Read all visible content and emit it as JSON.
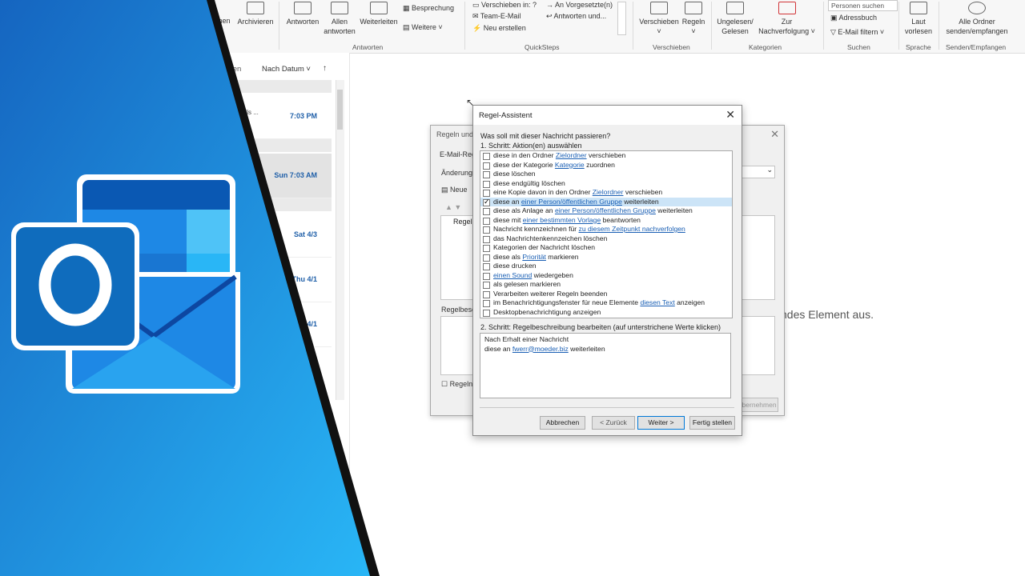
{
  "ribbon": {
    "buttons": {
      "loeschen_partial": "chen",
      "archivieren": "Archivieren",
      "antworten": "Antworten",
      "allen_antworten_1": "Allen",
      "allen_antworten_2": "antworten",
      "weiterleiten": "Weiterleiten",
      "besprechung": "Besprechung",
      "weitere": "Weitere ˅",
      "qs_verschieben": "Verschieben in: ?",
      "qs_team": "Team-E-Mail",
      "qs_neu": "Neu erstellen",
      "qs_vorgesetzte": "An Vorgesetzte(n)",
      "qs_antworten_und": "Antworten und...",
      "verschieben": "Verschieben",
      "regeln": "Regeln",
      "ungelesen_1": "Ungelesen/",
      "ungelesen_2": "Gelesen",
      "zur_1": "Zur",
      "zur_2": "Nachverfolgung ˅",
      "personen_suchen": "Personen suchen",
      "adressbuch": "Adressbuch",
      "email_filtern": "E-Mail filtern ˅",
      "laut_1": "Laut",
      "laut_2": "vorlesen",
      "alle_1": "Alle Ordner",
      "alle_2": "senden/empfangen"
    },
    "groups": {
      "antworten": "Antworten",
      "quicksteps": "QuickSteps",
      "verschieben": "Verschieben",
      "kategorien": "Kategorien",
      "suchen": "Suchen",
      "sprache": "Sprache",
      "senden": "Senden/Empfangen"
    }
  },
  "msglist": {
    "filter_partial": "sen",
    "sort": "Nach Datum ˅",
    "sort_arrow": "↑",
    "rows": [
      {
        "time": "7:03 PM",
        "text": "ails ..."
      },
      {
        "time": "Sun 7:03 AM",
        "text": ""
      },
      {
        "time": "Sat 4/3",
        "text": ""
      },
      {
        "time": "Thu 4/1",
        "text": ""
      },
      {
        "time": "4/1",
        "text": ""
      }
    ]
  },
  "reading_hint": "ndes Element aus.",
  "rules_dialog": {
    "title": "Regeln und",
    "tab": "E-Mail-Reg",
    "changes": "Änderung",
    "new": "Neue",
    "col_rule": "Regel",
    "desc": "Regelbesc",
    "enable": "Regeln",
    "apply": "Übernehmen"
  },
  "wizard": {
    "title": "Regel-Assistent",
    "question": "Was soll mit dieser Nachricht passieren?",
    "step1": "1. Schritt: Aktion(en) auswählen",
    "actions": [
      {
        "pre": "diese in den Ordner ",
        "link": "Zielordner",
        "post": " verschieben"
      },
      {
        "pre": "diese der Kategorie ",
        "link": "Kategorie",
        "post": " zuordnen"
      },
      {
        "pre": "diese löschen",
        "link": "",
        "post": ""
      },
      {
        "pre": "diese endgültig löschen",
        "link": "",
        "post": ""
      },
      {
        "pre": "eine Kopie davon in den Ordner ",
        "link": "Zielordner",
        "post": " verschieben"
      },
      {
        "pre": "diese an ",
        "link": "einer Person/öffentlichen Gruppe",
        "post": " weiterleiten"
      },
      {
        "pre": "diese als Anlage an ",
        "link": "einer Person/öffentlichen Gruppe",
        "post": " weiterleiten"
      },
      {
        "pre": "diese mit ",
        "link": "einer bestimmten Vorlage",
        "post": " beantworten"
      },
      {
        "pre": "Nachricht kennzeichnen für ",
        "link": "zu diesem Zeitpunkt nachverfolgen",
        "post": ""
      },
      {
        "pre": "das Nachrichtenkennzeichen löschen",
        "link": "",
        "post": ""
      },
      {
        "pre": "Kategorien der Nachricht löschen",
        "link": "",
        "post": ""
      },
      {
        "pre": "diese als ",
        "link": "Priorität",
        "post": " markieren"
      },
      {
        "pre": "diese drucken",
        "link": "",
        "post": ""
      },
      {
        "pre": "",
        "link": "einen Sound",
        "post": " wiedergeben"
      },
      {
        "pre": "als gelesen markieren",
        "link": "",
        "post": ""
      },
      {
        "pre": "Verarbeiten weiterer Regeln beenden",
        "link": "",
        "post": ""
      },
      {
        "pre": "im Benachrichtigungsfenster für neue Elemente ",
        "link": "diesen Text",
        "post": " anzeigen"
      },
      {
        "pre": "Desktopbenachrichtigung anzeigen",
        "link": "",
        "post": ""
      }
    ],
    "selected_index": 5,
    "step2": "2. Schritt: Regelbeschreibung bearbeiten (auf unterstrichene Werte klicken)",
    "desc_line1": "Nach Erhalt einer Nachricht",
    "desc_line2_pre": "diese an ",
    "desc_line2_link": "fwerr@moeder.biz",
    "desc_line2_post": " weiterleiten",
    "buttons": {
      "cancel": "Abbrechen",
      "back": "< Zurück",
      "next": "Weiter >",
      "finish": "Fertig stellen"
    }
  },
  "colors": {
    "outlook_blue": "#0f6cbd",
    "link": "#1a5fb4",
    "selection": "#cce4f7"
  }
}
